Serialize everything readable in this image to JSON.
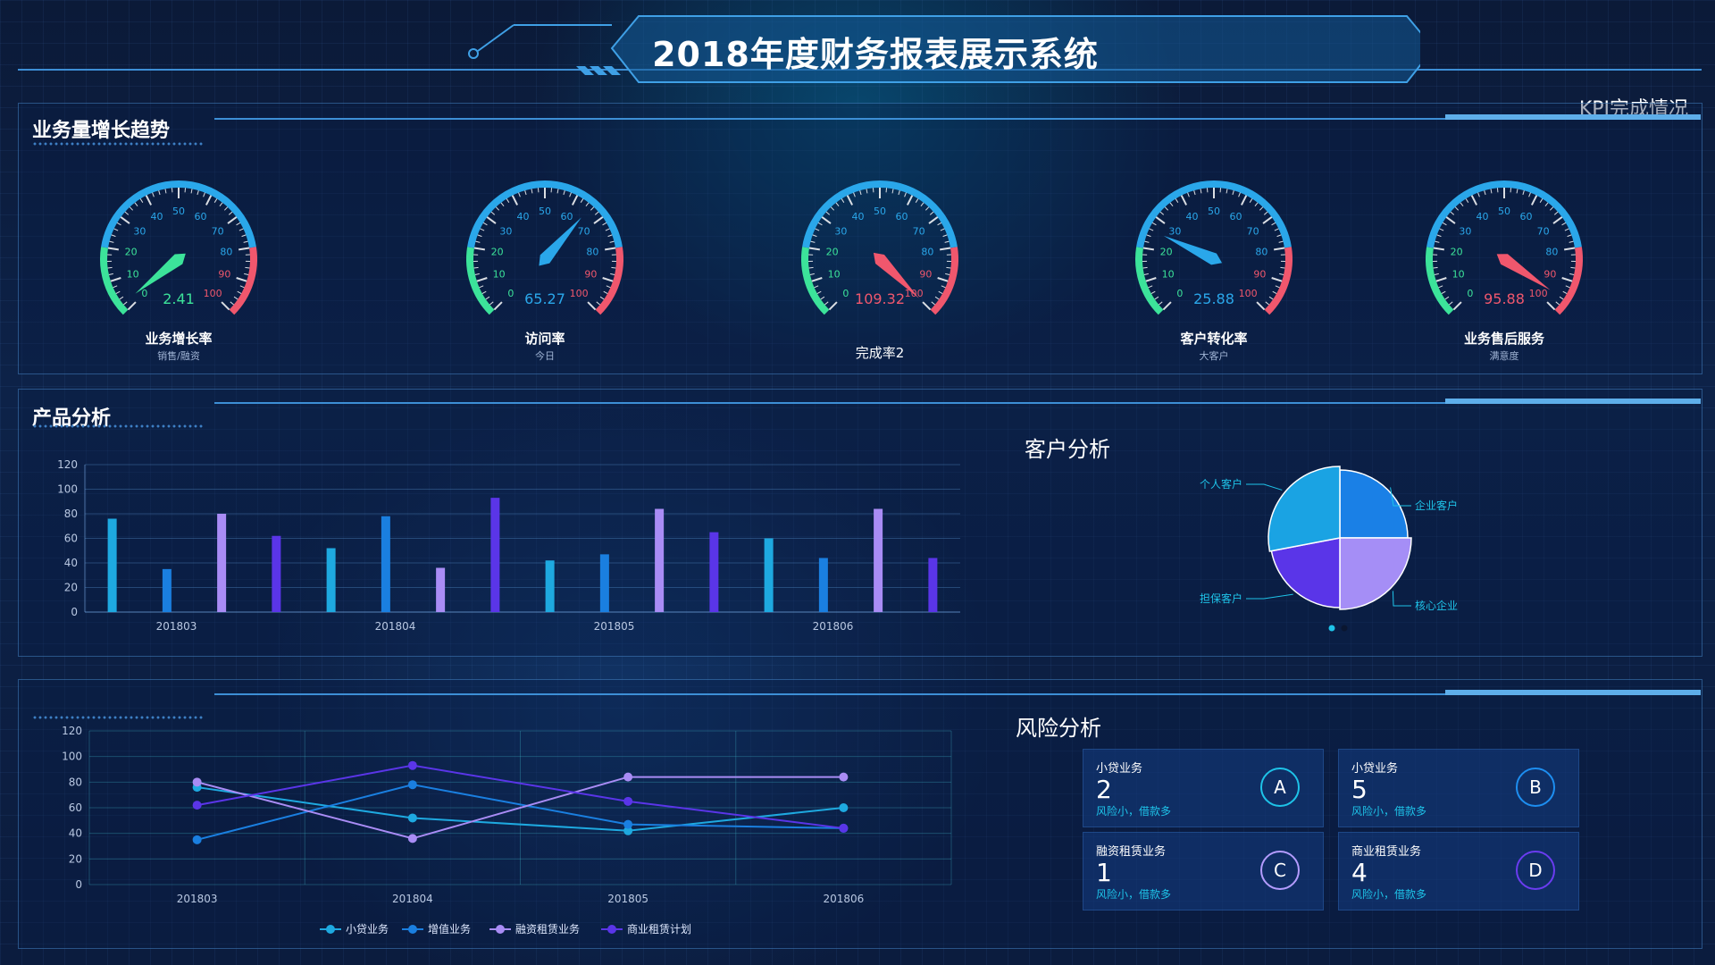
{
  "header": {
    "title": "2018年度财务报表展示系统"
  },
  "kpi": {
    "title": "KPI完成情况"
  },
  "growth_panel": {
    "title": "业务量增长趋势",
    "gauges": [
      {
        "label": "业务增长率",
        "sub": "销售/融资",
        "value": 2.41,
        "value_text": "2.41",
        "color": "#3ce39a"
      },
      {
        "label": "访问率",
        "sub": "今日",
        "value": 65.27,
        "value_text": "65.27",
        "color": "#2aa7ea"
      },
      {
        "label": "完成率2",
        "sub": "",
        "value": 109.32,
        "value_text": "109.32",
        "color": "#f0576d"
      },
      {
        "label": "客户转化率",
        "sub": "大客户",
        "value": 25.88,
        "value_text": "25.88",
        "color": "#2aa7ea"
      },
      {
        "label": "业务售后服务",
        "sub": "满意度",
        "value": 95.88,
        "value_text": "95.88",
        "color": "#f0576d"
      }
    ],
    "tick_labels": [
      "0",
      "10",
      "20",
      "30",
      "40",
      "50",
      "60",
      "70",
      "80",
      "90",
      "100"
    ]
  },
  "product_panel": {
    "title": "产品分析"
  },
  "customer_panel": {
    "title": "客户分析"
  },
  "risk_panel": {
    "title": "风险分析",
    "cards": [
      {
        "name": "小贷业务",
        "count": "2",
        "note": "风险小，借款多",
        "badge": "A",
        "color": "#1ec3e8"
      },
      {
        "name": "小贷业务",
        "count": "5",
        "note": "风险小，借款多",
        "badge": "B",
        "color": "#1d8ef0"
      },
      {
        "name": "融资租赁业务",
        "count": "1",
        "note": "风险小，借款多",
        "badge": "C",
        "color": "#b49cff"
      },
      {
        "name": "商业租赁业务",
        "count": "4",
        "note": "风险小，借款多",
        "badge": "D",
        "color": "#6a3cf0"
      }
    ]
  },
  "chart_data": [
    {
      "type": "bar",
      "categories": [
        "201803",
        "201804",
        "201805",
        "201806"
      ],
      "ylim": [
        0,
        120
      ],
      "yticks": [
        0,
        20,
        40,
        60,
        80,
        100,
        120
      ],
      "grid": true,
      "series": [
        {
          "color": "#1ea9e0",
          "values": [
            76,
            52,
            42,
            60
          ]
        },
        {
          "color": "#1a7fe0",
          "values": [
            35,
            78,
            47,
            44
          ]
        },
        {
          "color": "#a98cf5",
          "values": [
            80,
            36,
            84,
            84
          ]
        },
        {
          "color": "#5a35e8",
          "values": [
            62,
            93,
            65,
            44
          ]
        }
      ]
    },
    {
      "type": "pie",
      "slices": [
        {
          "label": "企业客户",
          "value": 25,
          "color": "#1a80e6"
        },
        {
          "label": "核心企业",
          "value": 25,
          "color": "#a58ef6"
        },
        {
          "label": "担保客户",
          "value": 22,
          "color": "#5a35e8"
        },
        {
          "label": "个人客户",
          "value": 28,
          "color": "#1aa3e3"
        }
      ]
    },
    {
      "type": "line",
      "categories": [
        "201803",
        "201804",
        "201805",
        "201806"
      ],
      "ylim": [
        0,
        120
      ],
      "yticks": [
        0,
        20,
        40,
        60,
        80,
        100,
        120
      ],
      "grid": true,
      "legend": "bottom",
      "series": [
        {
          "name": "小贷业务",
          "color": "#1ea9e0",
          "values": [
            76,
            52,
            42,
            60
          ]
        },
        {
          "name": "增值业务",
          "color": "#1a7fe0",
          "values": [
            35,
            78,
            47,
            44
          ]
        },
        {
          "name": "融资租赁业务",
          "color": "#a98cf5",
          "values": [
            80,
            36,
            84,
            84
          ]
        },
        {
          "name": "商业租赁计划",
          "color": "#5a35e8",
          "values": [
            62,
            93,
            65,
            44
          ]
        }
      ]
    }
  ]
}
